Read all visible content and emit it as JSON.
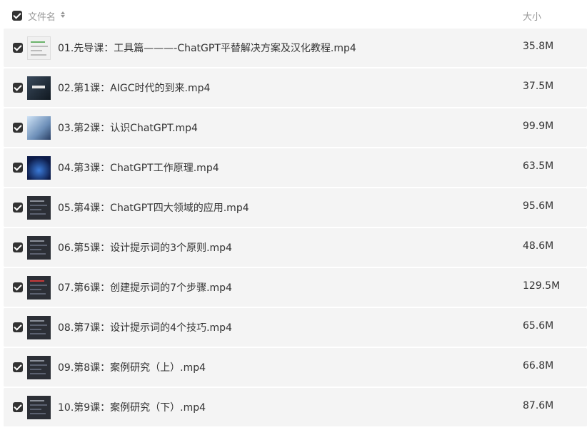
{
  "header": {
    "name_label": "文件名",
    "size_label": "大小"
  },
  "files": [
    {
      "name": "01.先导课：工具篇———-ChatGPT平替解决方案及汉化教程.mp4",
      "size": "35.8M"
    },
    {
      "name": "02.第1课：AIGC时代的到来.mp4",
      "size": "37.5M"
    },
    {
      "name": "03.第2课：认识ChatGPT.mp4",
      "size": "99.9M"
    },
    {
      "name": "04.第3课：ChatGPT工作原理.mp4",
      "size": "63.5M"
    },
    {
      "name": "05.第4课：ChatGPT四大领域的应用.mp4",
      "size": "95.6M"
    },
    {
      "name": "06.第5课：设计提示词的3个原则.mp4",
      "size": "48.6M"
    },
    {
      "name": "07.第6课：创建提示词的7个步骤.mp4",
      "size": "129.5M"
    },
    {
      "name": "08.第7课：设计提示词的4个技巧.mp4",
      "size": "65.6M"
    },
    {
      "name": "09.第8课：案例研究（上）.mp4",
      "size": "66.8M"
    },
    {
      "name": "10.第9课：案例研究（下）.mp4",
      "size": "87.6M"
    }
  ]
}
